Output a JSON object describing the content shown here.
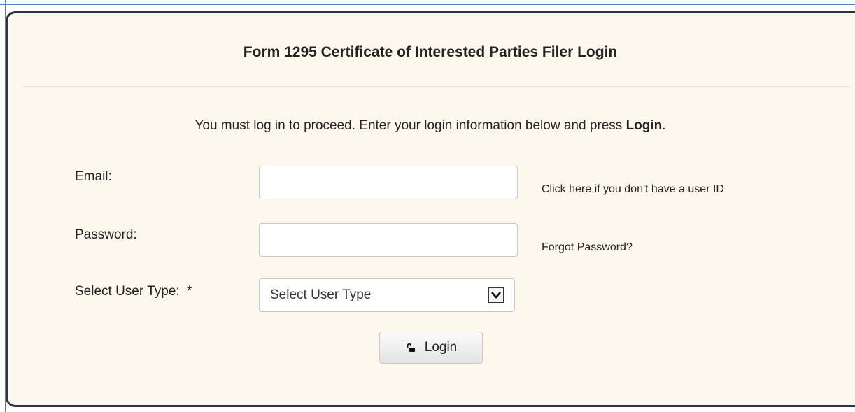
{
  "panel": {
    "title": "Form 1295 Certificate of Interested Parties Filer Login",
    "instructions_prefix": "You must log in to proceed. Enter your login information below and press ",
    "instructions_bold": "Login",
    "instructions_suffix": "."
  },
  "form": {
    "email": {
      "label": "Email:",
      "value": "",
      "link": "Click here if you don't have a user ID"
    },
    "password": {
      "label": "Password:",
      "value": "",
      "link": "Forgot Password?"
    },
    "user_type": {
      "label": "Select User Type:  *",
      "selected": "Select User Type"
    },
    "login_button": {
      "label": "Login",
      "icon": "lock-icon"
    }
  },
  "colors": {
    "panel_background": "#fdf8ee",
    "panel_border": "#2b3440"
  }
}
